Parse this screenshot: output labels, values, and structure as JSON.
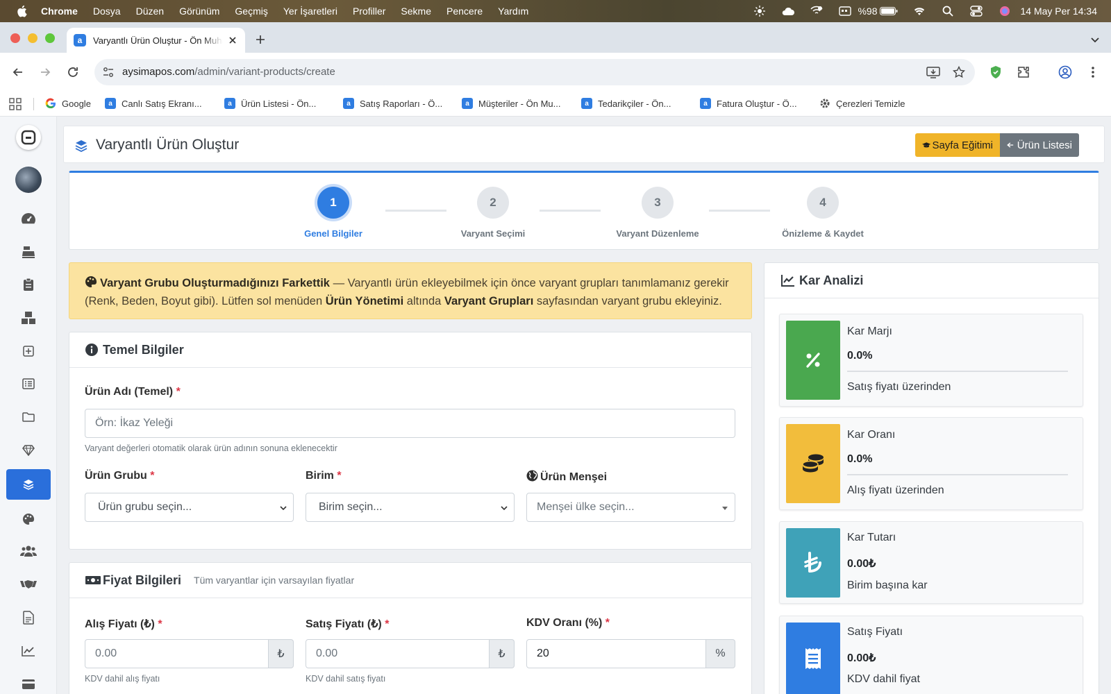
{
  "menubar": {
    "app": "Chrome",
    "items": [
      "Dosya",
      "Düzen",
      "Görünüm",
      "Geçmiş",
      "Yer İşaretleri",
      "Profiller",
      "Sekme",
      "Pencere",
      "Yardım"
    ],
    "battery": "%98",
    "datetime": "14 May Per  14:34"
  },
  "browser": {
    "tab_title": "Varyantlı Ürün Oluştur - Ön Muhasebe",
    "url_domain": "aysimapos.com",
    "url_path": "/admin/variant-products/create",
    "bookmarks": [
      "Google",
      "Canlı Satış Ekranı...",
      "Ürün Listesi - Ön...",
      "Satış Raporları - Ö...",
      "Müşteriler - Ön Mu...",
      "Tedarikçiler - Ön...",
      "Fatura Oluştur - Ö...",
      "Çerezleri Temizle"
    ]
  },
  "header": {
    "title": "Varyantlı Ürün Oluştur",
    "btn_training": "Sayfa Eğitimi",
    "btn_list": "Ürün Listesi"
  },
  "wizard": {
    "steps": [
      {
        "num": "1",
        "label": "Genel Bilgiler"
      },
      {
        "num": "2",
        "label": "Varyant Seçimi"
      },
      {
        "num": "3",
        "label": "Varyant Düzenleme"
      },
      {
        "num": "4",
        "label": "Önizleme & Kaydet"
      }
    ],
    "active": 1
  },
  "alert": {
    "title": "Varyant Grubu Oluşturmadığınızı Farkettik",
    "text1": " — Varyantlı ürün ekleyebilmek için önce varyant grupları tanımlamanız gerekir (Renk, Beden, Boyut gibi). Lütfen sol menüden ",
    "bold1": "Ürün Yönetimi",
    "text2": " altında ",
    "bold2": "Varyant Grupları",
    "text3": " sayfasından varyant grubu ekleyiniz."
  },
  "basic": {
    "title": "Temel Bilgiler",
    "name_label": "Ürün Adı (Temel)",
    "name_placeholder": "Örn: İkaz Yeleği",
    "name_help": "Varyant değerleri otomatik olarak ürün adının sonuna eklenecektir",
    "group_label": "Ürün Grubu",
    "group_placeholder": "Ürün grubu seçin...",
    "unit_label": "Birim",
    "unit_placeholder": "Birim seçin...",
    "origin_label": "Ürün Menşei",
    "origin_placeholder": "Menşei ülke seçin..."
  },
  "price": {
    "title": "Fiyat Bilgileri",
    "subtitle": "Tüm varyantlar için varsayılan fiyatlar",
    "buy_label": "Alış Fiyatı (₺)",
    "buy_placeholder": "0.00",
    "buy_help": "KDV dahil alış fiyatı",
    "sell_label": "Satış Fiyatı (₺)",
    "sell_placeholder": "0.00",
    "sell_help": "KDV dahil satış fiyatı",
    "vat_label": "KDV Oranı (%)",
    "vat_value": "20",
    "currency": "₺",
    "percent": "%"
  },
  "profit": {
    "title": "Kar Analizi",
    "cards": [
      {
        "title": "Kar Marjı",
        "value": "0.0%",
        "sub": "Satış fiyatı üzerinden",
        "color": "#4aa84f"
      },
      {
        "title": "Kar Oranı",
        "value": "0.0%",
        "sub": "Alış fiyatı üzerinden",
        "color": "#f2bd3c"
      },
      {
        "title": "Kar Tutarı",
        "value": "0.00₺",
        "sub": "Birim başına kar",
        "color": "#3fa2b8"
      },
      {
        "title": "Satış Fiyatı",
        "value": "0.00₺",
        "sub": "KDV dahil fiyat",
        "color": "#2f7de1"
      }
    ]
  },
  "colors": {
    "primary": "#2f7de1",
    "warning": "#f0b429",
    "secondary": "#6c757d",
    "alert_bg": "#fbe3a0"
  },
  "sidebar_icons": [
    "dashboard-icon",
    "cash-register-icon",
    "clipboard-icon",
    "boxes-icon",
    "plus-square-icon",
    "list-icon",
    "folder-icon",
    "gem-icon",
    "layers-icon",
    "palette-icon",
    "users-icon",
    "handshake-icon",
    "file-icon",
    "chart-line-icon",
    "credit-card-icon"
  ]
}
